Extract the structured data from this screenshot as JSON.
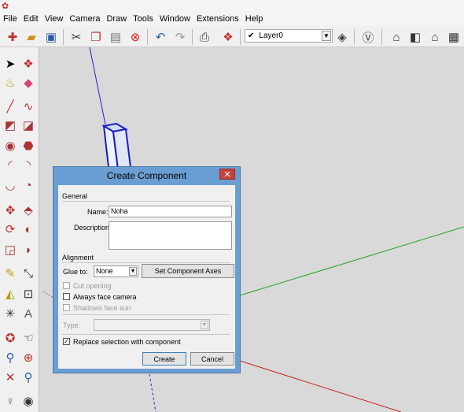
{
  "menu": [
    "File",
    "Edit",
    "View",
    "Camera",
    "Draw",
    "Tools",
    "Window",
    "Extensions",
    "Help"
  ],
  "toolbar": {
    "icons": [
      "new-icon",
      "open-icon",
      "save-icon",
      "cut-icon",
      "copy-icon",
      "paste-icon",
      "erase-icon",
      "undo-icon",
      "redo-icon",
      "print-icon",
      "model-info-icon"
    ],
    "layer_check": "✔",
    "layer_name": "Layer0",
    "right_icons": [
      "layer-manager-icon",
      "styles-icon",
      "warehouse-icon",
      "components-icon",
      "home-icon",
      "front-view-icon"
    ]
  },
  "dialog": {
    "title": "Create Component",
    "close": "✕",
    "general": "General",
    "name_label": "Name:",
    "name_value": "Noha",
    "description_label": "Description:",
    "description_value": "",
    "alignment": "Alignment",
    "glue_label": "Glue to:",
    "glue_value": "None",
    "set_axes": "Set Component Axes",
    "cut_opening": "Cut opening",
    "always_face_camera": "Always face camera",
    "shadows_face_sun": "Shadows face sun",
    "type_label": "Type:",
    "type_value": "",
    "replace_selection": "Replace selection with component",
    "create": "Create",
    "cancel": "Cancel"
  }
}
